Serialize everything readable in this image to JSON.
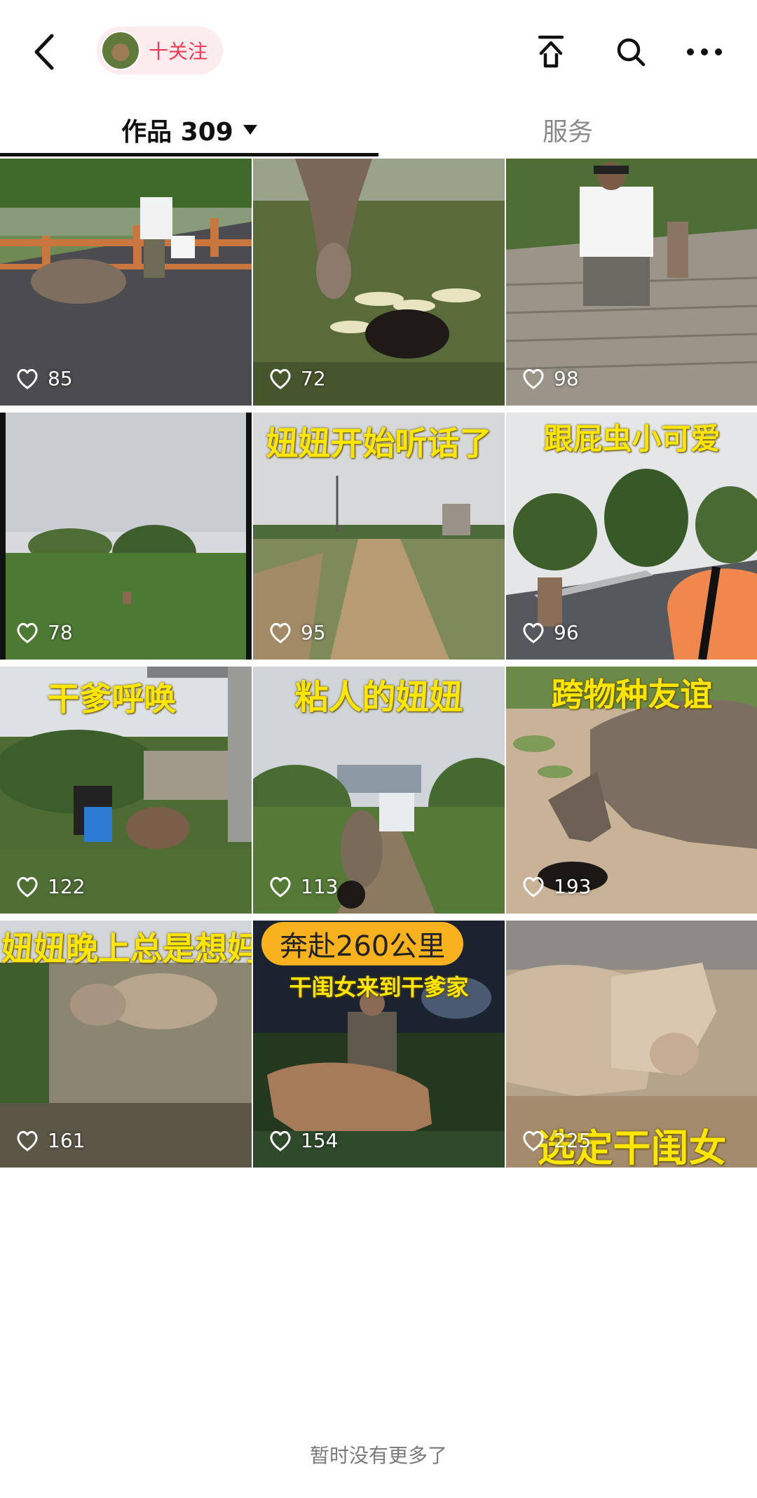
{
  "header": {
    "back_icon": "back-arrow-icon",
    "follow_label": "十关注",
    "share_icon": "share-icon",
    "search_icon": "search-icon",
    "more_icon": "more-dots-icon"
  },
  "tabs": {
    "works_label": "作品 309",
    "services_label": "服务"
  },
  "accent_color": "#f23b57",
  "videos": [
    {
      "likes": "85",
      "caption": ""
    },
    {
      "likes": "72",
      "caption": ""
    },
    {
      "likes": "98",
      "caption": ""
    },
    {
      "likes": "78",
      "caption": ""
    },
    {
      "likes": "95",
      "caption": "妞妞开始听话了"
    },
    {
      "likes": "96",
      "caption": "跟屁虫小可爱"
    },
    {
      "likes": "122",
      "caption": "干爹呼唤"
    },
    {
      "likes": "113",
      "caption": "粘人的妞妞"
    },
    {
      "likes": "193",
      "caption": "跨物种友谊"
    },
    {
      "likes": "161",
      "caption": "妞妞晚上总是想妈妈"
    },
    {
      "likes": "154",
      "caption": "干闺女来到干爹家",
      "badge": "奔赴260公里"
    },
    {
      "likes": "225",
      "caption": "选定干闺女"
    }
  ],
  "footer": {
    "end_text": "暂时没有更多了"
  }
}
